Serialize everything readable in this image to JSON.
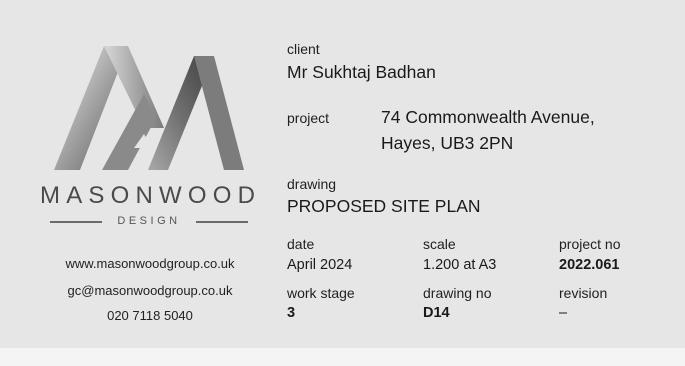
{
  "brand": {
    "name": "MASONWOOD",
    "sub": "DESIGN"
  },
  "contact": {
    "website": "www.masonwoodgroup.co.uk",
    "email": "gc@masonwoodgroup.co.uk",
    "phone": "020 7118 5040"
  },
  "client": {
    "label": "client",
    "value": "Mr Sukhtaj Badhan"
  },
  "project": {
    "label": "project",
    "line1": "74 Commonwealth Avenue,",
    "line2": "Hayes, UB3 2PN"
  },
  "drawing": {
    "label": "drawing",
    "value": "PROPOSED SITE PLAN"
  },
  "details": {
    "date": {
      "label": "date",
      "value": "April 2024"
    },
    "scale": {
      "label": "scale",
      "value": "1.200 at A3"
    },
    "project_no": {
      "label": "project no",
      "value": "2022.061"
    },
    "work_stage": {
      "label": "work stage",
      "value": "3"
    },
    "drawing_no": {
      "label": "drawing no",
      "value": "D14"
    },
    "revision": {
      "label": "revision",
      "value": "–"
    }
  }
}
